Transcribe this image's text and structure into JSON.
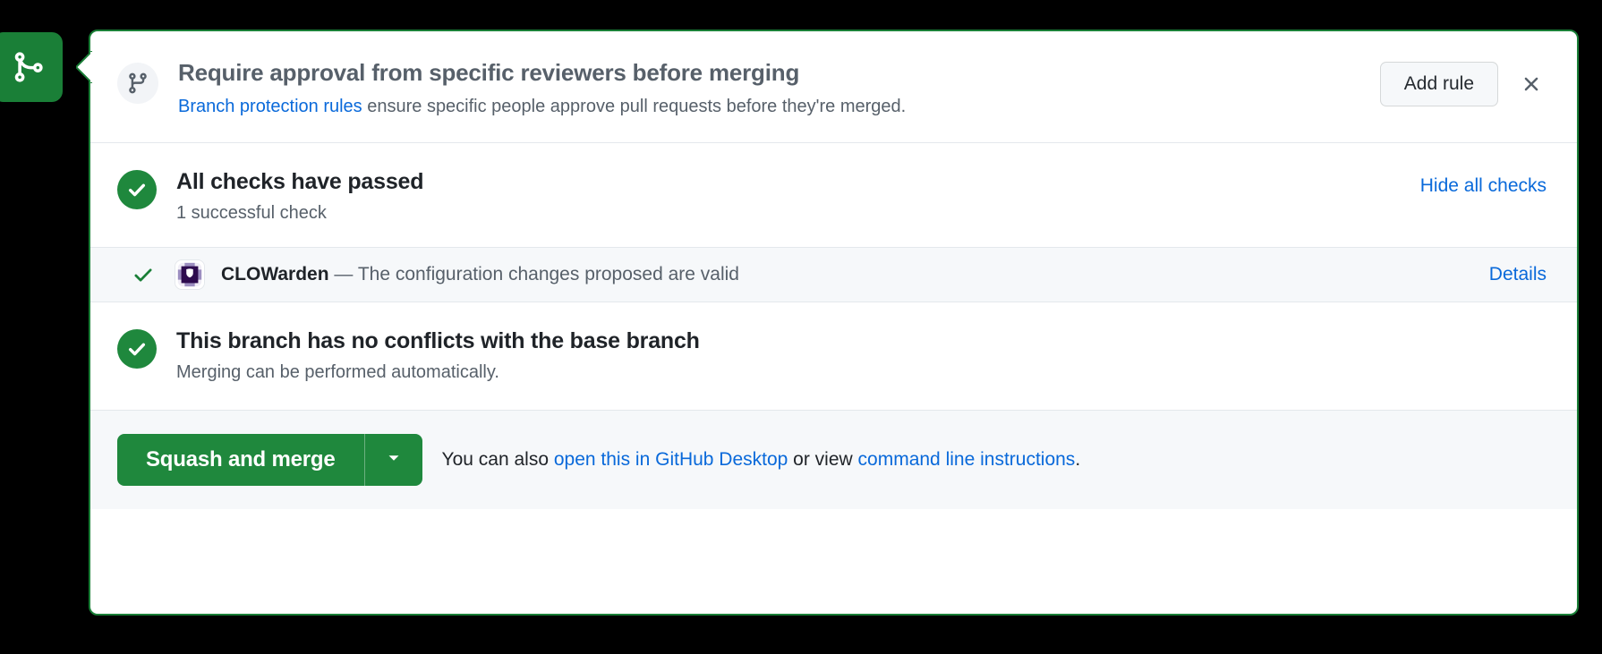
{
  "badge": {
    "icon": "git-merge-icon",
    "color": "#1a7f37"
  },
  "card": {
    "border_color": "#1a7f37",
    "header": {
      "icon": "git-branch-icon",
      "title": "Require approval from specific reviewers before merging",
      "description_link": "Branch protection rules",
      "description_rest": " ensure specific people approve pull requests before they're merged.",
      "add_rule_label": "Add rule",
      "close_icon": "close-icon"
    },
    "checks": {
      "status_icon": "check-circle-icon",
      "status_color": "#1f883d",
      "title": "All checks have passed",
      "subtitle": "1 successful check",
      "hide_all_label": "Hide all checks",
      "rows": [
        {
          "tick_icon": "check-icon",
          "avatar_icon": "clowarden-avatar-icon",
          "name": "CLOWarden",
          "separator": " — ",
          "description": "The configuration changes proposed are valid",
          "details_label": "Details"
        }
      ]
    },
    "conflicts": {
      "status_icon": "check-circle-icon",
      "title": "This branch has no conflicts with the base branch",
      "subtitle": "Merging can be performed automatically."
    },
    "footer": {
      "merge_label": "Squash and merge",
      "caret_icon": "chevron-down-icon",
      "note_prefix": "You can also ",
      "note_link1": "open this in GitHub Desktop",
      "note_middle": " or view ",
      "note_link2": "command line instructions",
      "note_suffix": "."
    }
  }
}
